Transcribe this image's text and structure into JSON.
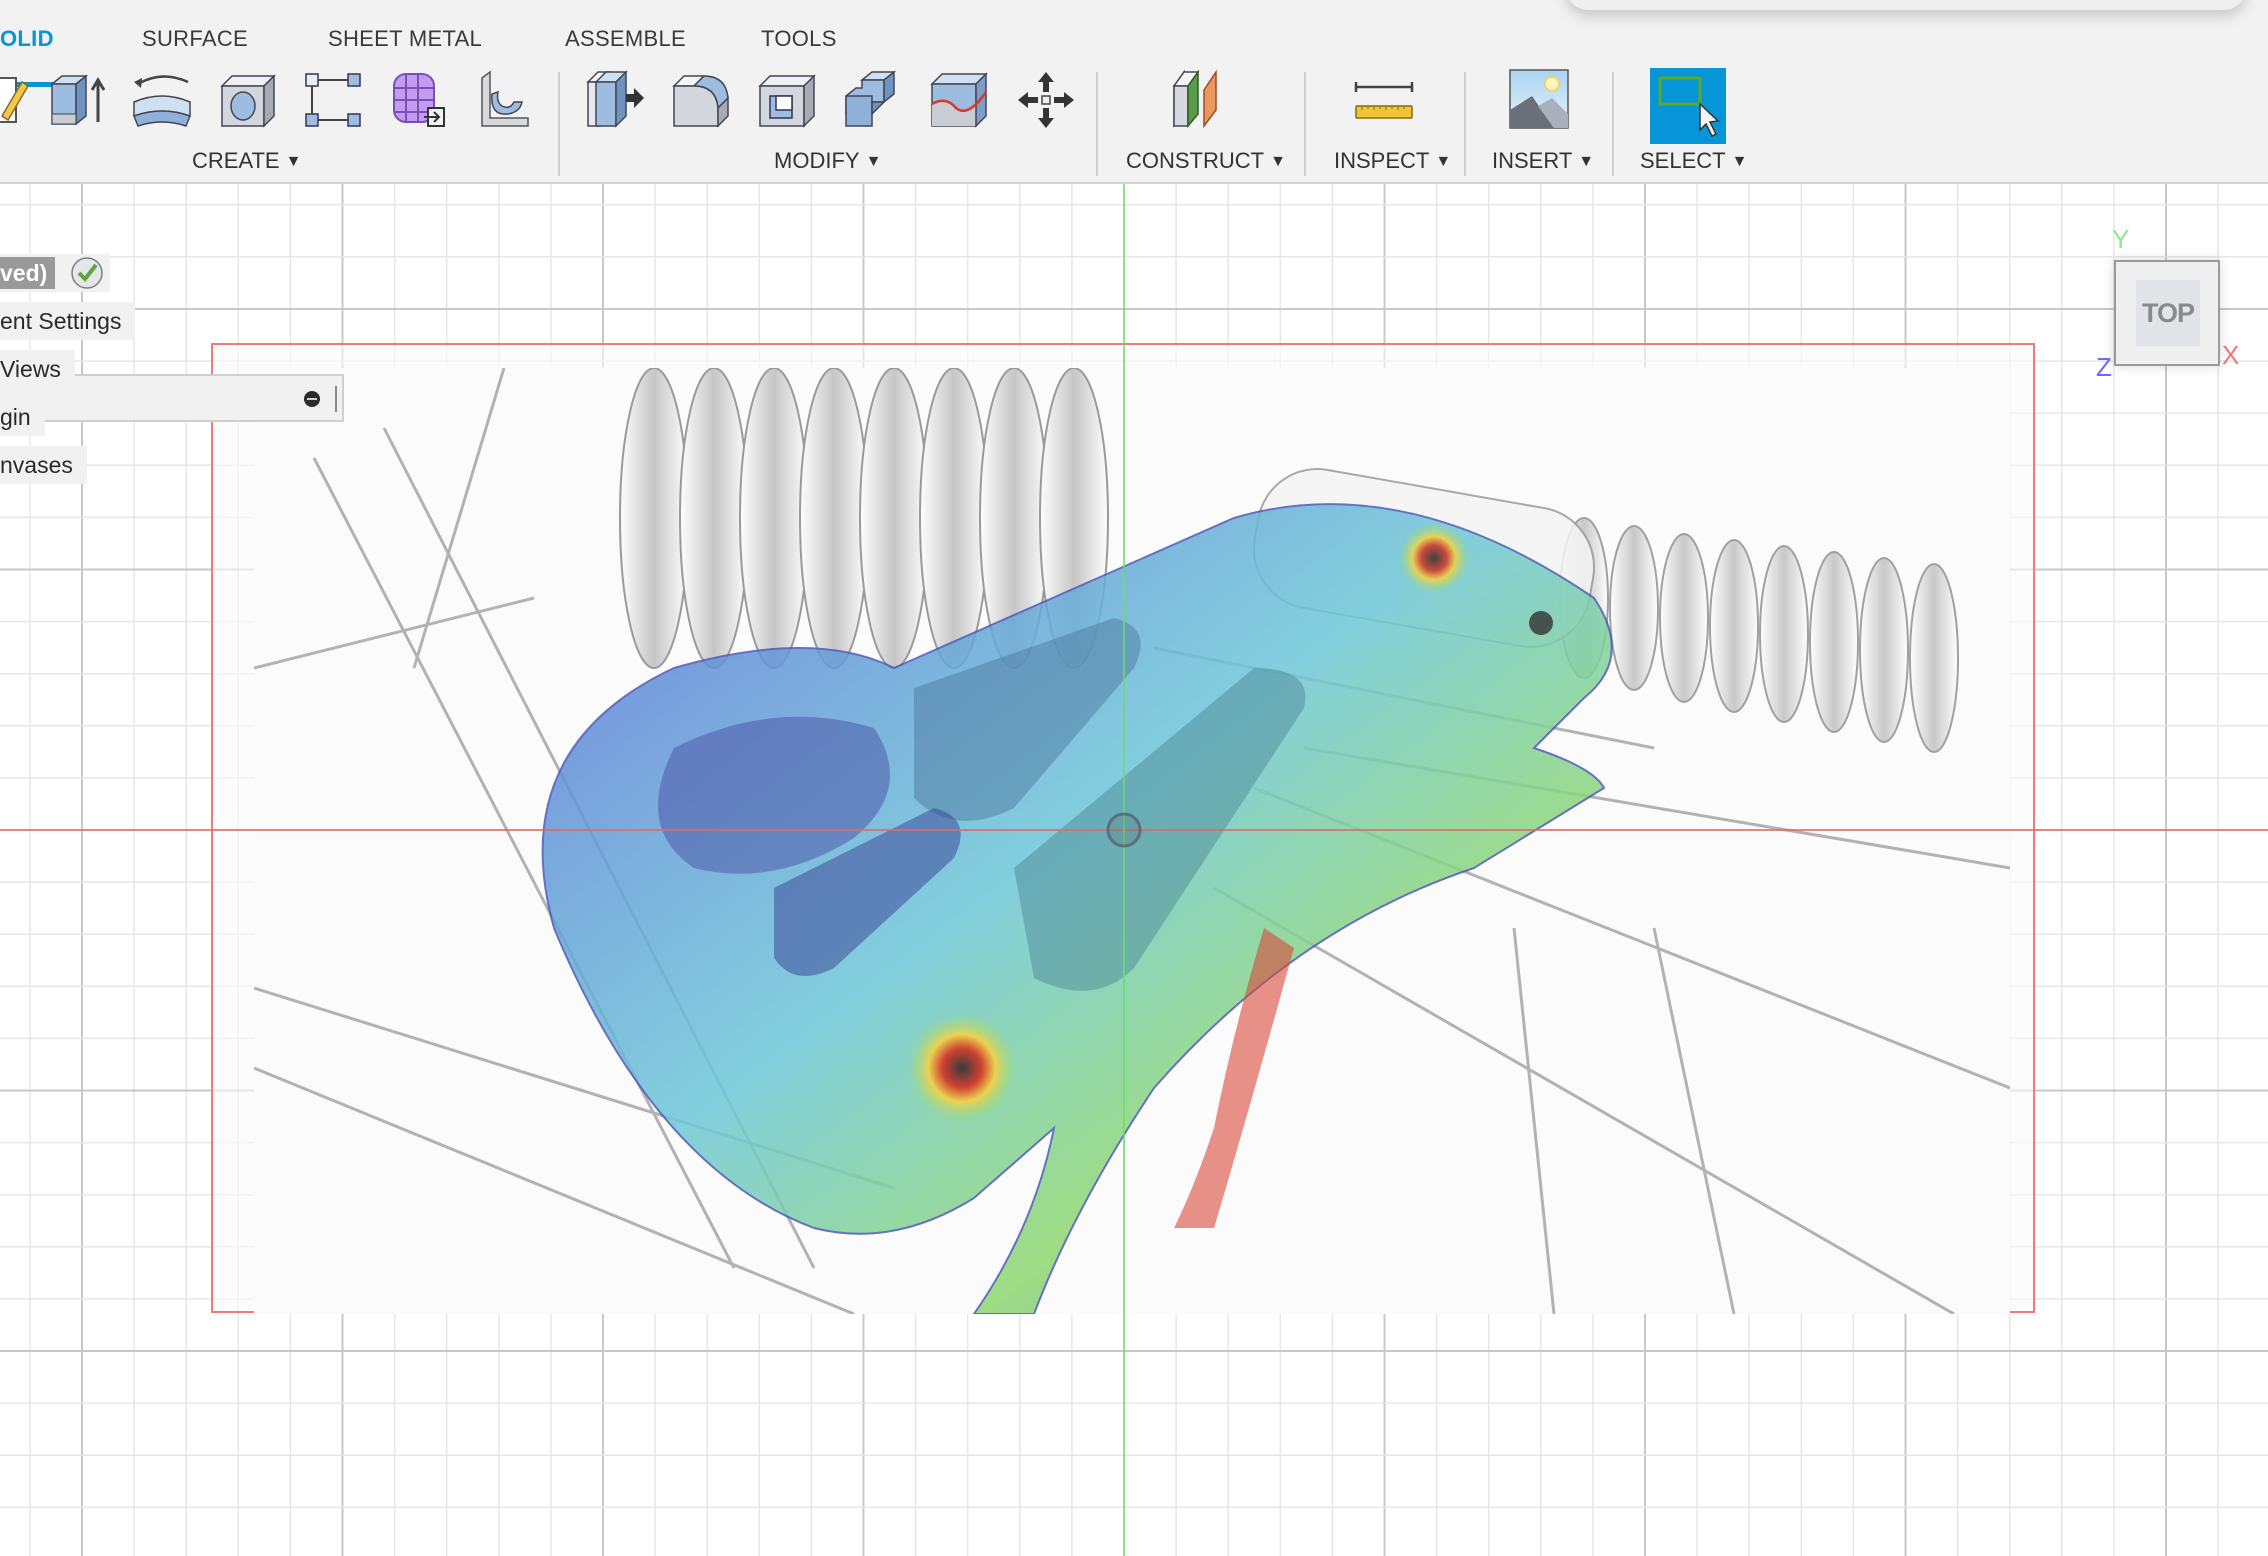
{
  "tabs": [
    {
      "label": "OLID",
      "active": true
    },
    {
      "label": "SURFACE",
      "active": false
    },
    {
      "label": "SHEET METAL",
      "active": false
    },
    {
      "label": "ASSEMBLE",
      "active": false
    },
    {
      "label": "TOOLS",
      "active": false
    }
  ],
  "toolbar": {
    "groups": [
      {
        "label": "CREATE",
        "tools": [
          "sketch",
          "extrude",
          "revolve",
          "hole",
          "pattern",
          "create-form",
          "create-base-feature"
        ]
      },
      {
        "label": "MODIFY",
        "tools": [
          "press-pull",
          "fillet",
          "shell",
          "combine",
          "replace-face",
          "move-copy"
        ]
      },
      {
        "label": "CONSTRUCT",
        "tools": [
          "offset-plane"
        ]
      },
      {
        "label": "INSPECT",
        "tools": [
          "measure"
        ]
      },
      {
        "label": "INSERT",
        "tools": [
          "insert-image"
        ]
      },
      {
        "label": "SELECT",
        "tools": [
          "window-select"
        ]
      }
    ],
    "caret": "▼",
    "select_color": "#0696d7",
    "tab_active_color": "#0696d7"
  },
  "browser": {
    "document_label": "ved)",
    "rows": [
      {
        "label": "ent Settings"
      },
      {
        "label": " Views"
      },
      {
        "label": "gin"
      },
      {
        "label": "nvases"
      }
    ]
  },
  "viewcube": {
    "face": "TOP",
    "axes": {
      "x": "X",
      "y": "Y",
      "z": "Z"
    },
    "axis_colors": {
      "x": "#f07a7a",
      "y": "#8ee88e",
      "z": "#6b6bff"
    }
  },
  "canvas": {
    "attached_image": "suspension bracket stress analysis render (canvas)",
    "axis_colors": {
      "x_axis": "#e06a6a",
      "y_axis": "#6fdc6f"
    }
  }
}
